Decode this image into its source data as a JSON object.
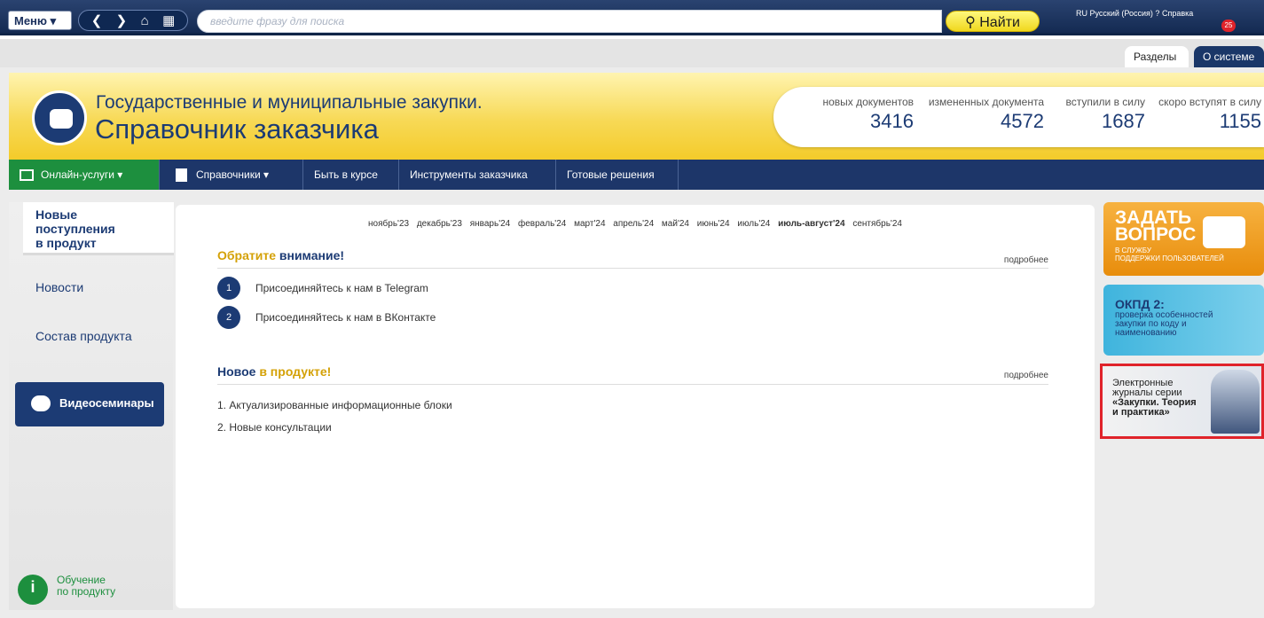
{
  "toolbar": {
    "menu_label": "Меню ▾",
    "search_placeholder": "введите фразу для поиска",
    "find_label": "Найти",
    "lang_label": "RU Русский (Россия)",
    "help_label": "Справка",
    "notification_count": "25"
  },
  "tabs": {
    "sections": "Разделы",
    "about": "О системе"
  },
  "banner": {
    "line1": "Государственные и муниципальные закупки.",
    "line2": "Справочник заказчика",
    "stats": [
      {
        "label": "новых документов",
        "value": "3416"
      },
      {
        "label": "измененных документа",
        "value": "4572"
      },
      {
        "label": "вступили в силу",
        "value": "1687"
      },
      {
        "label": "скоро вступят в силу",
        "value": "1155"
      }
    ]
  },
  "nav": {
    "online": "Онлайн-услуги ▾",
    "references": "Справочники ▾",
    "stay_informed": "Быть в курсе",
    "tools": "Инструменты заказчика",
    "ready": "Готовые решения"
  },
  "sidebar": {
    "active_l1": "Новые",
    "active_l2": "поступления",
    "active_l3": "в продукт",
    "news": "Новости",
    "composition": "Состав продукта",
    "video": "Видеосеминары",
    "learn_l1": "Обучение",
    "learn_l2": "по продукту"
  },
  "months": [
    "ноябрь'23",
    "декабрь'23",
    "январь'24",
    "февраль'24",
    "март'24",
    "апрель'24",
    "май'24",
    "июнь'24",
    "июль'24",
    "июль-август'24",
    "сентябрь'24"
  ],
  "attention": {
    "title_a": "Обратите ",
    "title_b": "внимание!",
    "more": "подробнее",
    "items": [
      "Присоединяйтесь к нам в Telegram",
      "Присоединяйтесь к нам в ВКонтакте"
    ],
    "nums": [
      "1",
      "2"
    ]
  },
  "new_in_product": {
    "title_a": "Новое ",
    "title_b": "в продукте!",
    "more": "подробнее",
    "items": [
      "1.   Актуализированные информационные блоки",
      "2.   Новые консультации"
    ]
  },
  "cards": {
    "ask_big1": "ЗАДАТЬ",
    "ask_big2": "ВОПРОС",
    "ask_small1": "В СЛУЖБУ",
    "ask_small2": "ПОДДЕРЖКИ ПОЛЬЗОВАТЕЛЕЙ",
    "okpd_title": "ОКПД 2:",
    "okpd_text": "проверка особенностей закупки по коду и наименованию",
    "journ_l1": "Электронные",
    "journ_l2": "журналы серии",
    "journ_l3": "«Закупки. Теория",
    "journ_l4": "и практика»"
  }
}
